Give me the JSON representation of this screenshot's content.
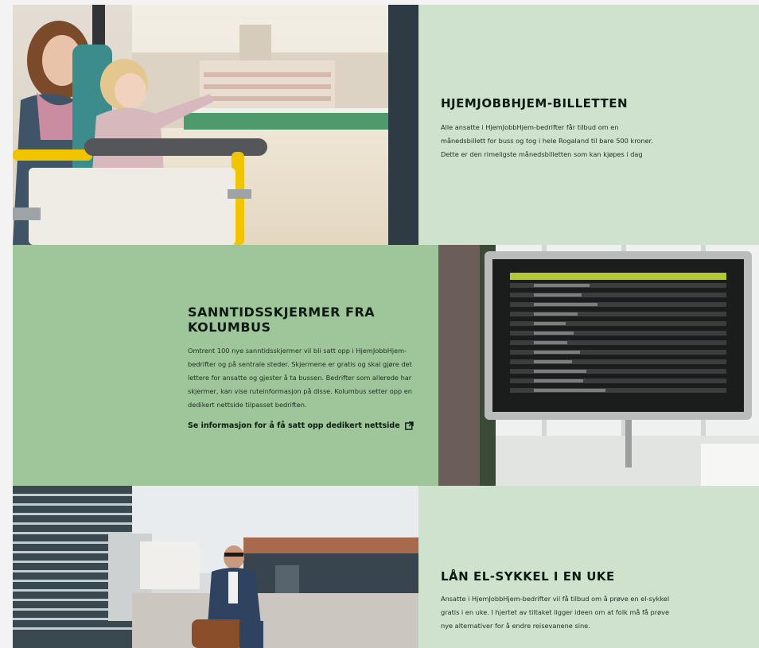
{
  "sections": [
    {
      "title": "HJEMJOBBHJEM-BILLETTEN",
      "body": "Alle ansatte i HjemJobbHjem-bedrifter får tilbud om en månedsbillett for buss og tog i hele Rogaland til bare 500 kroner. Dette er den rimeligste månedsbilletten som kan kjøpes i dag",
      "image_alt": "mother-and-child-on-bus-photo"
    },
    {
      "title": "SANNTIDSSKJERMER FRA KOLUMBUS",
      "body": "Omtrent 100 nye sanntidsskjermer vil bli satt opp i HjemJobbHjem-bedrifter og på sentrale steder. Skjermene er gratis og skal gjøre det lettere for ansatte og gjester å ta bussen. Bedrifter som allerede har skjermer, kan vise ruteinformasjon på disse. Kolumbus setter opp en dedikert nettside tilpasset bedriften.",
      "link": "Se informasjon for å få satt opp dedikert nettside",
      "link_icon": "external-link-icon",
      "image_alt": "realtime-departure-screen-photo"
    },
    {
      "title": "LÅN EL-SYKKEL I EN UKE",
      "body": "Ansatte i HjemJobbHjem-bedrifter vil få tilbud om å prøve en el-sykkel gratis i en uke. I hjertet av tiltaket ligger ideen om at folk må få prøve nye alternativer for å endre reisevanene sine.",
      "image_alt": "man-on-electric-bike-photo"
    }
  ],
  "colors": {
    "panel_light": "#cfe2cd",
    "panel_mid": "#9fc69a",
    "text_dark": "#0d1a12",
    "screen_accent": "#b4c832"
  }
}
